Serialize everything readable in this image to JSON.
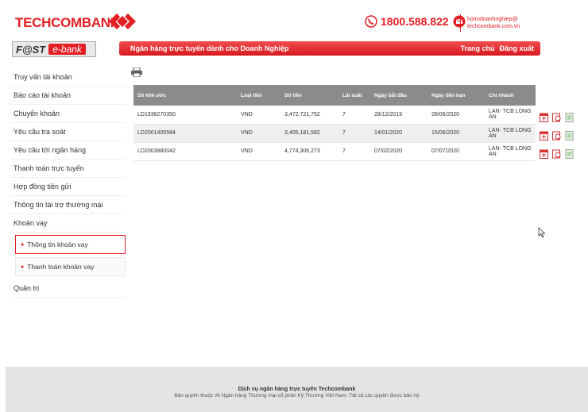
{
  "header": {
    "brand": "TECHCOMBANK",
    "hotline": "1800.588.822",
    "email_line1": "hotrodoanhnghiep@",
    "email_line2": "techcombank.com.vn"
  },
  "banner": {
    "fast_label": "F@ST",
    "ebank_label": "e-bank",
    "tagline": "Ngân hàng trực tuyến dành cho Doanh Nghiệp",
    "home_link": "Trang chủ",
    "logout_link": "Đăng xuất"
  },
  "sidebar": {
    "items": [
      "Truy vấn tài khoản",
      "Báo cáo tài khoản",
      "Chuyển khoản",
      "Yêu cầu tra soát",
      "Yêu cầu tới ngân hàng",
      "Thanh toán trực tuyến",
      "Hợp đồng tiền gửi",
      "Thông tin tài trợ thương mại",
      "Khoản vay"
    ],
    "sub_items": [
      "Thông tin khoản vay",
      "Thanh toán khoản vay"
    ],
    "last_item": "Quản trị"
  },
  "table": {
    "headers": [
      "Số khế ước",
      "Loại tiền",
      "Số tiền",
      "Lãi suất",
      "Ngày bắt đầu",
      "Ngày đến hạn",
      "Chi nhánh"
    ],
    "rows": [
      [
        "LD1936270350",
        "VND",
        "3,472,721,752",
        "7",
        "28/12/2019",
        "28/06/2020",
        "LAN- TCB LONG AN"
      ],
      [
        "LD2001405584",
        "VND",
        "3,405,181,582",
        "7",
        "14/01/2020",
        "15/06/2020",
        "LAN- TCB LONG AN"
      ],
      [
        "LD2003880042",
        "VND",
        "4,774,306,273",
        "7",
        "07/02/2020",
        "07/07/2020",
        "LAN- TCB LONG AN"
      ]
    ]
  },
  "footer": {
    "line1": "Dịch vụ ngân hàng trực tuyến Techcombank",
    "line2": "Bản quyền thuộc về Ngân hàng Thương mại cổ phần Kỹ Thương Việt Nam. Tất cả các quyền được bảo hộ"
  },
  "colors": {
    "brand_red": "#e31e24",
    "table_header": "#8b8b8b",
    "footer_bg": "#e4e4e4"
  }
}
